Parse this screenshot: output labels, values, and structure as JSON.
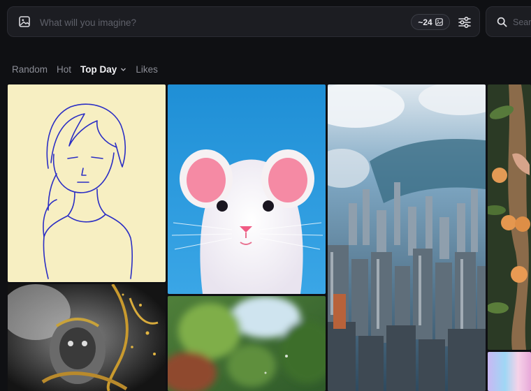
{
  "prompt_bar": {
    "placeholder": "What will you imagine?",
    "image_count": "~24",
    "image_icon": "image-icon",
    "settings_icon": "sliders-icon"
  },
  "search": {
    "placeholder": "Search",
    "icon": "search-icon"
  },
  "tabs": [
    {
      "label": "Random",
      "active": false
    },
    {
      "label": "Hot",
      "active": false
    },
    {
      "label": "Top Day",
      "active": true
    },
    {
      "label": "Likes",
      "active": false
    }
  ],
  "gallery": {
    "items": [
      {
        "subject": "sketch-girl"
      },
      {
        "subject": "white-mouse"
      },
      {
        "subject": "city-aerial"
      },
      {
        "subject": "fruit-tree"
      },
      {
        "subject": "monkey-king"
      },
      {
        "subject": "blurred-foliage"
      },
      {
        "subject": "pastel-gradient"
      }
    ]
  },
  "colors": {
    "background": "#0f1013",
    "bar": "#1c1d22",
    "muted_text": "#8b8d96",
    "active_text": "#f2f2f5"
  }
}
